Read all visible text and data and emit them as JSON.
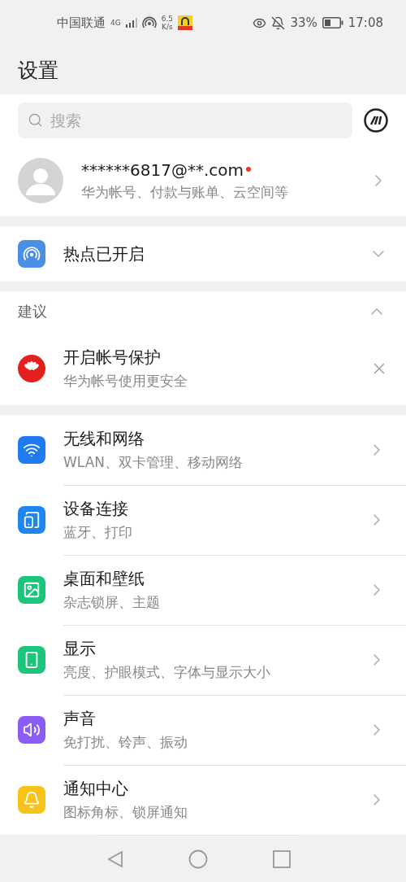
{
  "status_bar": {
    "carrier": "中国联通",
    "network": "4G",
    "speed_value": "6.5",
    "speed_unit": "K/s",
    "battery": "33%",
    "time": "17:08"
  },
  "title": "设置",
  "search": {
    "placeholder": "搜索"
  },
  "account": {
    "name": "******6817@**.com",
    "badge": true,
    "subtitle": "华为帐号、付款与账单、云空间等"
  },
  "hotspot": {
    "label": "热点已开启",
    "expanded": false
  },
  "suggestions": {
    "header": "建议",
    "expanded": true,
    "items": [
      {
        "title": "开启帐号保护",
        "subtitle": "华为帐号使用更安全"
      }
    ]
  },
  "settings": [
    {
      "kind": "wifi",
      "color": "#1f7bf0",
      "title": "无线和网络",
      "subtitle": "WLAN、双卡管理、移动网络"
    },
    {
      "kind": "devices",
      "color": "#1e86ee",
      "title": "设备连接",
      "subtitle": "蓝牙、打印"
    },
    {
      "kind": "wallpaper",
      "color": "#1dc47c",
      "title": "桌面和壁纸",
      "subtitle": "杂志锁屏、主题"
    },
    {
      "kind": "display",
      "color": "#1dc47c",
      "title": "显示",
      "subtitle": "亮度、护眼模式、字体与显示大小"
    },
    {
      "kind": "sound",
      "color": "#8b5cf6",
      "title": "声音",
      "subtitle": "免打扰、铃声、振动"
    },
    {
      "kind": "notification",
      "color": "#f7c31a",
      "title": "通知中心",
      "subtitle": "图标角标、锁屏通知"
    }
  ]
}
